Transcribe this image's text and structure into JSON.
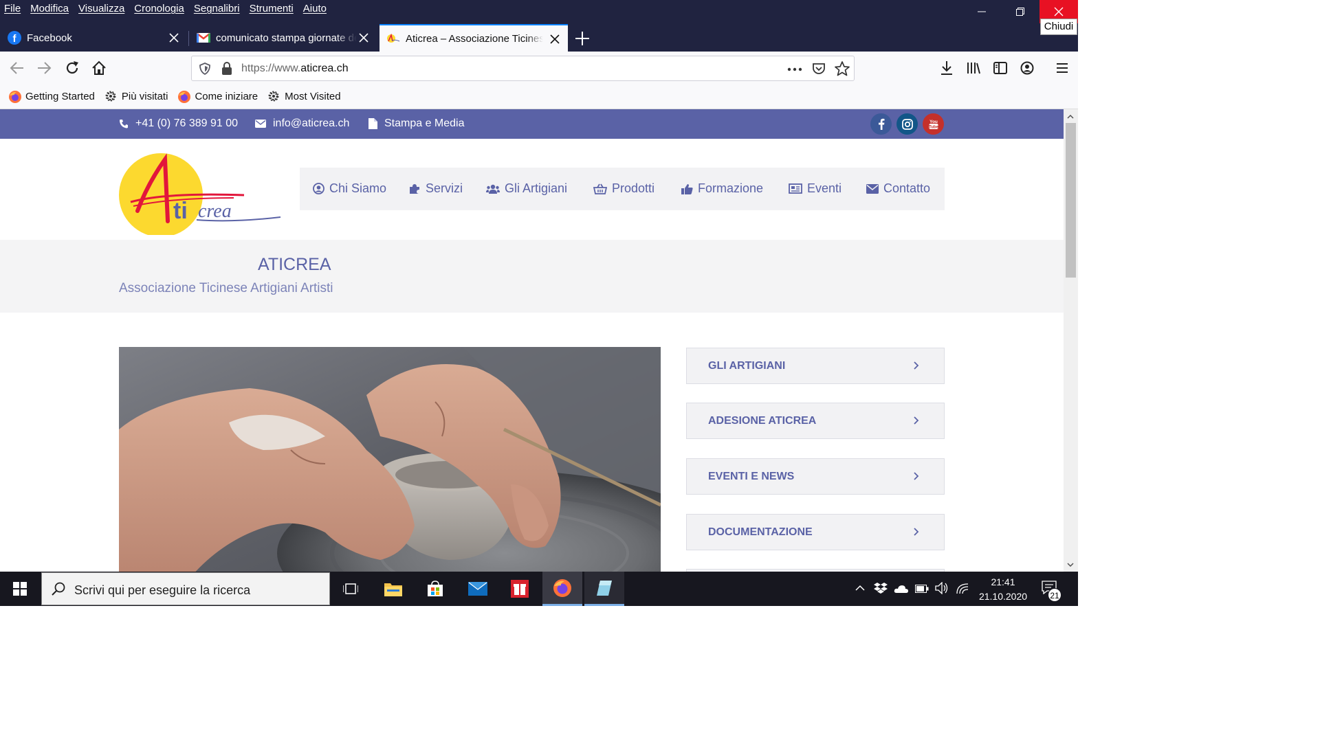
{
  "menubar": {
    "items": [
      "File",
      "Modifica",
      "Visualizza",
      "Cronologia",
      "Segnalibri",
      "Strumenti",
      "Aiuto"
    ]
  },
  "window": {
    "close_tooltip": "Chiudi"
  },
  "tabs": [
    {
      "label": "Facebook",
      "icon": "facebook-icon",
      "active": false
    },
    {
      "label": "comunicato stampa giornate de",
      "icon": "gmail-icon",
      "active": false
    },
    {
      "label": "Aticrea – Associazione Ticinese",
      "icon": "aticrea-favicon",
      "active": true
    }
  ],
  "navbar": {
    "url_prefix": "https://www.",
    "url_domain": "aticrea.ch"
  },
  "bookmarks": [
    {
      "label": "Getting Started",
      "icon": "firefox-icon"
    },
    {
      "label": "Più visitati",
      "icon": "gear-icon"
    },
    {
      "label": "Come iniziare",
      "icon": "firefox-icon"
    },
    {
      "label": "Most Visited",
      "icon": "gear-icon"
    }
  ],
  "site": {
    "topbar": {
      "phone": "+41 (0) 76 389 91 00",
      "email": "info@aticrea.ch",
      "press": "Stampa e Media"
    },
    "nav": [
      {
        "label": "Chi Siamo",
        "icon": "user-circle-icon"
      },
      {
        "label": "Servizi",
        "icon": "puzzle-icon"
      },
      {
        "label": "Gli Artigiani",
        "icon": "users-icon"
      },
      {
        "label": "Prodotti",
        "icon": "basket-icon"
      },
      {
        "label": "Formazione",
        "icon": "thumbs-up-icon"
      },
      {
        "label": "Eventi",
        "icon": "newspaper-icon"
      },
      {
        "label": "Contatto",
        "icon": "envelope-icon"
      }
    ],
    "logo": {
      "text_a": "A",
      "text_ti": "ti",
      "text_crea": "crea"
    },
    "title": "ATICREA",
    "subtitle": "Associazione Ticinese Artigiani Artisti",
    "sidebar": [
      {
        "label": "GLI ARTIGIANI"
      },
      {
        "label": "ADESIONE ATICREA"
      },
      {
        "label": "EVENTI E NEWS"
      },
      {
        "label": "DOCUMENTAZIONE"
      }
    ]
  },
  "taskbar": {
    "search_placeholder": "Scrivi qui per eseguire la ricerca",
    "time": "21:41",
    "date": "21.10.2020",
    "notifications": "21"
  },
  "colors": {
    "brand": "#5a62a6",
    "titlebar": "#202340",
    "close_red": "#e81123",
    "logo_yellow": "#fcd92f",
    "logo_red": "#e2163b"
  }
}
